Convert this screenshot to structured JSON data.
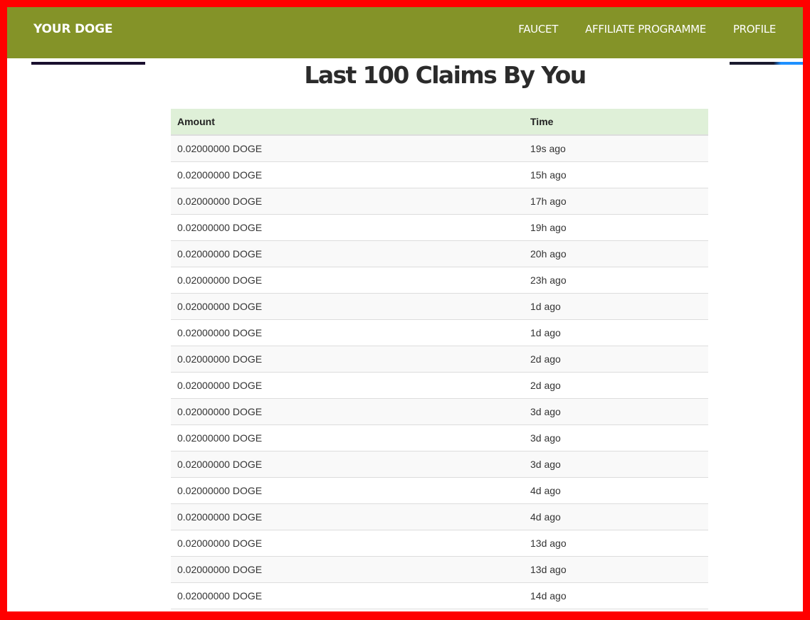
{
  "navbar": {
    "brand": "YOUR DOGE",
    "links": [
      {
        "label": "FAUCET"
      },
      {
        "label": "AFFILIATE PROGRAMME"
      },
      {
        "label": "PROFILE"
      }
    ]
  },
  "page": {
    "title": "Last 100 Claims By You"
  },
  "table": {
    "headers": {
      "amount": "Amount",
      "time": "Time"
    },
    "rows": [
      {
        "amount": "0.02000000 DOGE",
        "time": "19s ago"
      },
      {
        "amount": "0.02000000 DOGE",
        "time": "15h ago"
      },
      {
        "amount": "0.02000000 DOGE",
        "time": "17h ago"
      },
      {
        "amount": "0.02000000 DOGE",
        "time": "19h ago"
      },
      {
        "amount": "0.02000000 DOGE",
        "time": "20h ago"
      },
      {
        "amount": "0.02000000 DOGE",
        "time": "23h ago"
      },
      {
        "amount": "0.02000000 DOGE",
        "time": "1d ago"
      },
      {
        "amount": "0.02000000 DOGE",
        "time": "1d ago"
      },
      {
        "amount": "0.02000000 DOGE",
        "time": "2d ago"
      },
      {
        "amount": "0.02000000 DOGE",
        "time": "2d ago"
      },
      {
        "amount": "0.02000000 DOGE",
        "time": "3d ago"
      },
      {
        "amount": "0.02000000 DOGE",
        "time": "3d ago"
      },
      {
        "amount": "0.02000000 DOGE",
        "time": "3d ago"
      },
      {
        "amount": "0.02000000 DOGE",
        "time": "4d ago"
      },
      {
        "amount": "0.02000000 DOGE",
        "time": "4d ago"
      },
      {
        "amount": "0.02000000 DOGE",
        "time": "13d ago"
      },
      {
        "amount": "0.02000000 DOGE",
        "time": "13d ago"
      },
      {
        "amount": "0.02000000 DOGE",
        "time": "14d ago"
      }
    ]
  },
  "colors": {
    "navbar": "#849328",
    "border": "#ff0000",
    "table_header": "#dff0d8",
    "title_text": "#2b2b2b"
  }
}
